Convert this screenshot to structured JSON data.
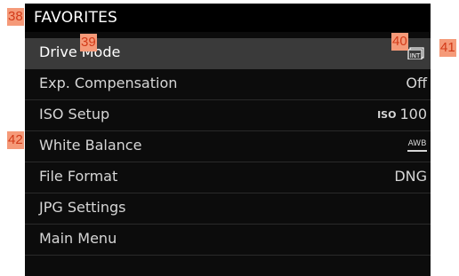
{
  "header": {
    "title": "FAVORITES"
  },
  "menu": {
    "items": [
      {
        "label": "Drive Mode",
        "value": "",
        "selected": true,
        "icon": "drive-mode-interval-icon"
      },
      {
        "label": "Exp. Compensation",
        "value": "Off"
      },
      {
        "label": "ISO Setup",
        "value_prefix": "ISO",
        "value": "100"
      },
      {
        "label": "White Balance",
        "value": "AWB",
        "icon": "awb-icon"
      },
      {
        "label": "File Format",
        "value": "DNG"
      },
      {
        "label": "JPG Settings",
        "value": ""
      },
      {
        "label": "Main Menu",
        "value": ""
      }
    ]
  },
  "callouts": [
    "38",
    "39",
    "40",
    "41",
    "42"
  ],
  "colors": {
    "screen": "#0c0c0c",
    "selected_row": "#3a3a3a",
    "callout_bg": "#f59a79",
    "callout_text": "#d23a18"
  }
}
